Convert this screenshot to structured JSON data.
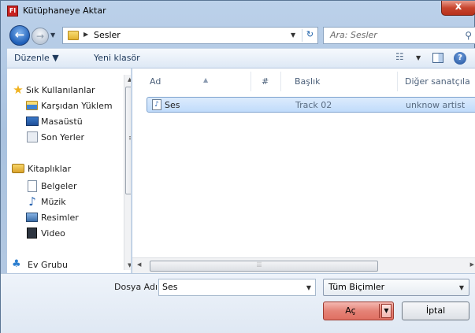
{
  "window": {
    "title": "Kütüphaneye Aktar",
    "app_icon_text": "Fl",
    "close_label": "x"
  },
  "address": {
    "path": "Sesler",
    "search_placeholder": "Ara: Sesler"
  },
  "toolbar": {
    "organize_label": "Düzenle ▼",
    "new_folder_label": "Yeni klasör",
    "help_label": "?"
  },
  "nav": {
    "items": [
      {
        "label": "Sık Kullanılanlar",
        "icon": "star-icon"
      },
      {
        "label": "Karşıdan Yüklem",
        "icon": "downloads-folder-icon"
      },
      {
        "label": "Masaüstü",
        "icon": "desktop-icon"
      },
      {
        "label": "Son Yerler",
        "icon": "recent-places-icon"
      },
      {
        "label": "Kitaplıklar",
        "icon": "libraries-icon"
      },
      {
        "label": "Belgeler",
        "icon": "documents-icon"
      },
      {
        "label": "Müzik",
        "icon": "music-icon"
      },
      {
        "label": "Resimler",
        "icon": "pictures-icon"
      },
      {
        "label": "Video",
        "icon": "video-icon"
      },
      {
        "label": "Ev Grubu",
        "icon": "homegroup-icon"
      }
    ]
  },
  "list": {
    "columns": [
      "Ad",
      "#",
      "Başlık",
      "Diğer sanatçıla"
    ],
    "rows": [
      {
        "name": "Ses",
        "number": "",
        "title": "Track 02",
        "artist": "unknow artist"
      }
    ]
  },
  "bottom": {
    "filename_label": "Dosya Adı:",
    "filename_value": "Ses",
    "filter_value": "Tüm Biçimler",
    "open_label": "Aç",
    "cancel_label": "İptal"
  },
  "colors": {
    "selection": "#c1dcfb",
    "open_button": "#e58377",
    "close_button": "#c8462f"
  }
}
